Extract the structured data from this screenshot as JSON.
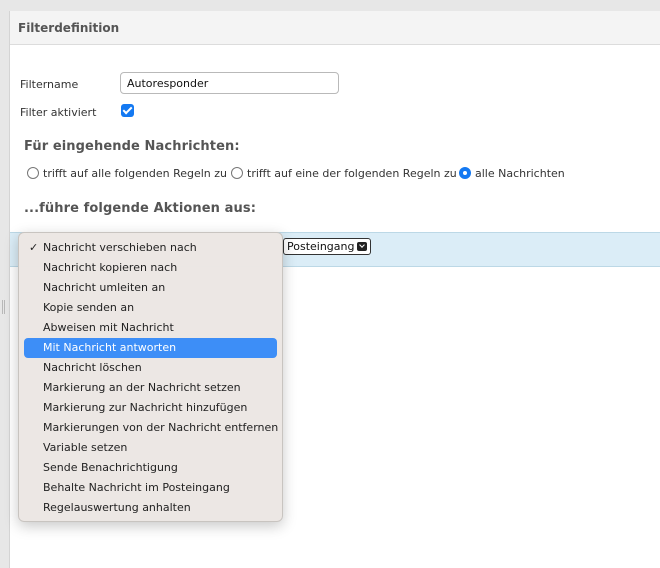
{
  "panel": {
    "title": "Filterdefinition"
  },
  "form": {
    "filtername_label": "Filtername",
    "filtername_value": "Autoresponder",
    "active_label": "Filter aktiviert",
    "active_checked": true
  },
  "incoming": {
    "title": "Für eingehende Nachrichten:",
    "options": [
      {
        "label": "trifft auf alle folgenden Regeln zu",
        "selected": false
      },
      {
        "label": "trifft auf eine der folgenden Regeln zu",
        "selected": false
      },
      {
        "label": "alle Nachrichten",
        "selected": true
      }
    ]
  },
  "actions": {
    "title": "...führe folgende Aktionen aus:",
    "folder_select_value": "Posteingang",
    "check_glyph": "✓",
    "menu_items": [
      "Nachricht verschieben nach",
      "Nachricht kopieren nach",
      "Nachricht umleiten an",
      "Kopie senden an",
      "Abweisen mit Nachricht",
      "Mit Nachricht antworten",
      "Nachricht löschen",
      "Markierung an der Nachricht setzen",
      "Markierung zur Nachricht hinzufügen",
      "Markierungen von der Nachricht entfernen",
      "Variable setzen",
      "Sende Benachrichtigung",
      "Behalte Nachricht im Posteingang",
      "Regelauswertung anhalten"
    ],
    "checked_index": 0,
    "highlighted_index": 5
  },
  "colors": {
    "accent": "#1479f2",
    "highlight": "#3d8ef7",
    "action_row": "#dbedf7"
  }
}
